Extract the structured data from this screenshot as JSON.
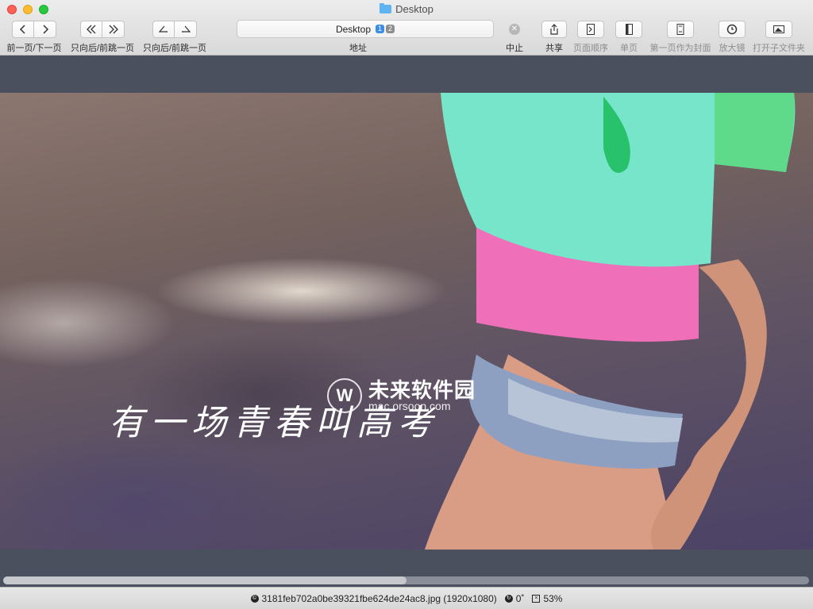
{
  "window": {
    "title": "Desktop"
  },
  "toolbar": {
    "prev_next_label": "前一页/下一页",
    "jump_back_label": "只向后/前跳一页",
    "jump_fwd_label": "只向后/前跳一页",
    "address": {
      "text": "Desktop",
      "badge_1": "1",
      "badge_2": "2",
      "label": "地址"
    },
    "stop_label": "中止",
    "share_label": "共享",
    "page_order_label": "页面顺序",
    "single_page_label": "单页",
    "first_page_cover_label": "第一页作为封面",
    "magnifier_label": "放大镜",
    "open_subfolder_label": "打开子文件夹"
  },
  "image": {
    "watermark_cn": "未来软件园",
    "watermark_url": "mac.orsoon.com",
    "caption": "有一场青春叫高考"
  },
  "scrollbar": {
    "thumb_fraction": 0.5
  },
  "status": {
    "filename": "3181feb702a0be39321fbe624de24ac8.jpg (1920x1080)",
    "rotation": "0˚",
    "zoom": "53%"
  },
  "colors": {
    "accent": "#3a8ee6",
    "viewer_bg": "#4a505e"
  }
}
